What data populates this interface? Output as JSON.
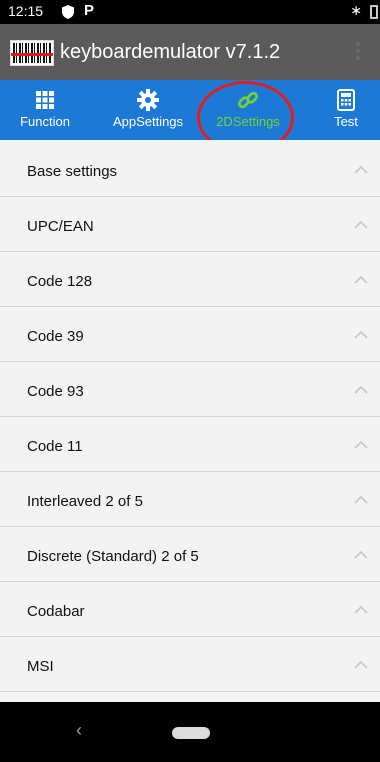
{
  "status_bar": {
    "time": "12:15",
    "icons": [
      "shield-icon",
      "parking-icon",
      "bluetooth-icon",
      "battery-icon"
    ],
    "p_glyph": "P",
    "bt_glyph": "∗"
  },
  "app_bar": {
    "title": "keyboardemulator v7.1.2",
    "logo": "barcode-scanner-logo"
  },
  "tabs": [
    {
      "label": "Function",
      "icon": "grid-icon",
      "active": false
    },
    {
      "label": "AppSettings",
      "icon": "gear-icon",
      "active": false
    },
    {
      "label": "2DSettings",
      "icon": "link-icon",
      "active": true
    },
    {
      "label": "Test",
      "icon": "calculator-icon",
      "active": false
    }
  ],
  "settings_sections": [
    {
      "label": "Base settings"
    },
    {
      "label": "UPC/EAN"
    },
    {
      "label": "Code 128"
    },
    {
      "label": "Code 39"
    },
    {
      "label": "Code 93"
    },
    {
      "label": "Code 11"
    },
    {
      "label": "Interleaved 2 of 5"
    },
    {
      "label": "Discrete (Standard) 2 of 5"
    },
    {
      "label": "Codabar"
    },
    {
      "label": "MSI"
    }
  ],
  "nav_bar": {
    "back_glyph": "‹"
  },
  "colors": {
    "app_bar": "#5b5b5b",
    "tab_bar": "#1c7ad6",
    "active_tab": "#77cf3a",
    "annotation_circle": "#e31c1c",
    "list_bg": "#f3f3f3"
  }
}
